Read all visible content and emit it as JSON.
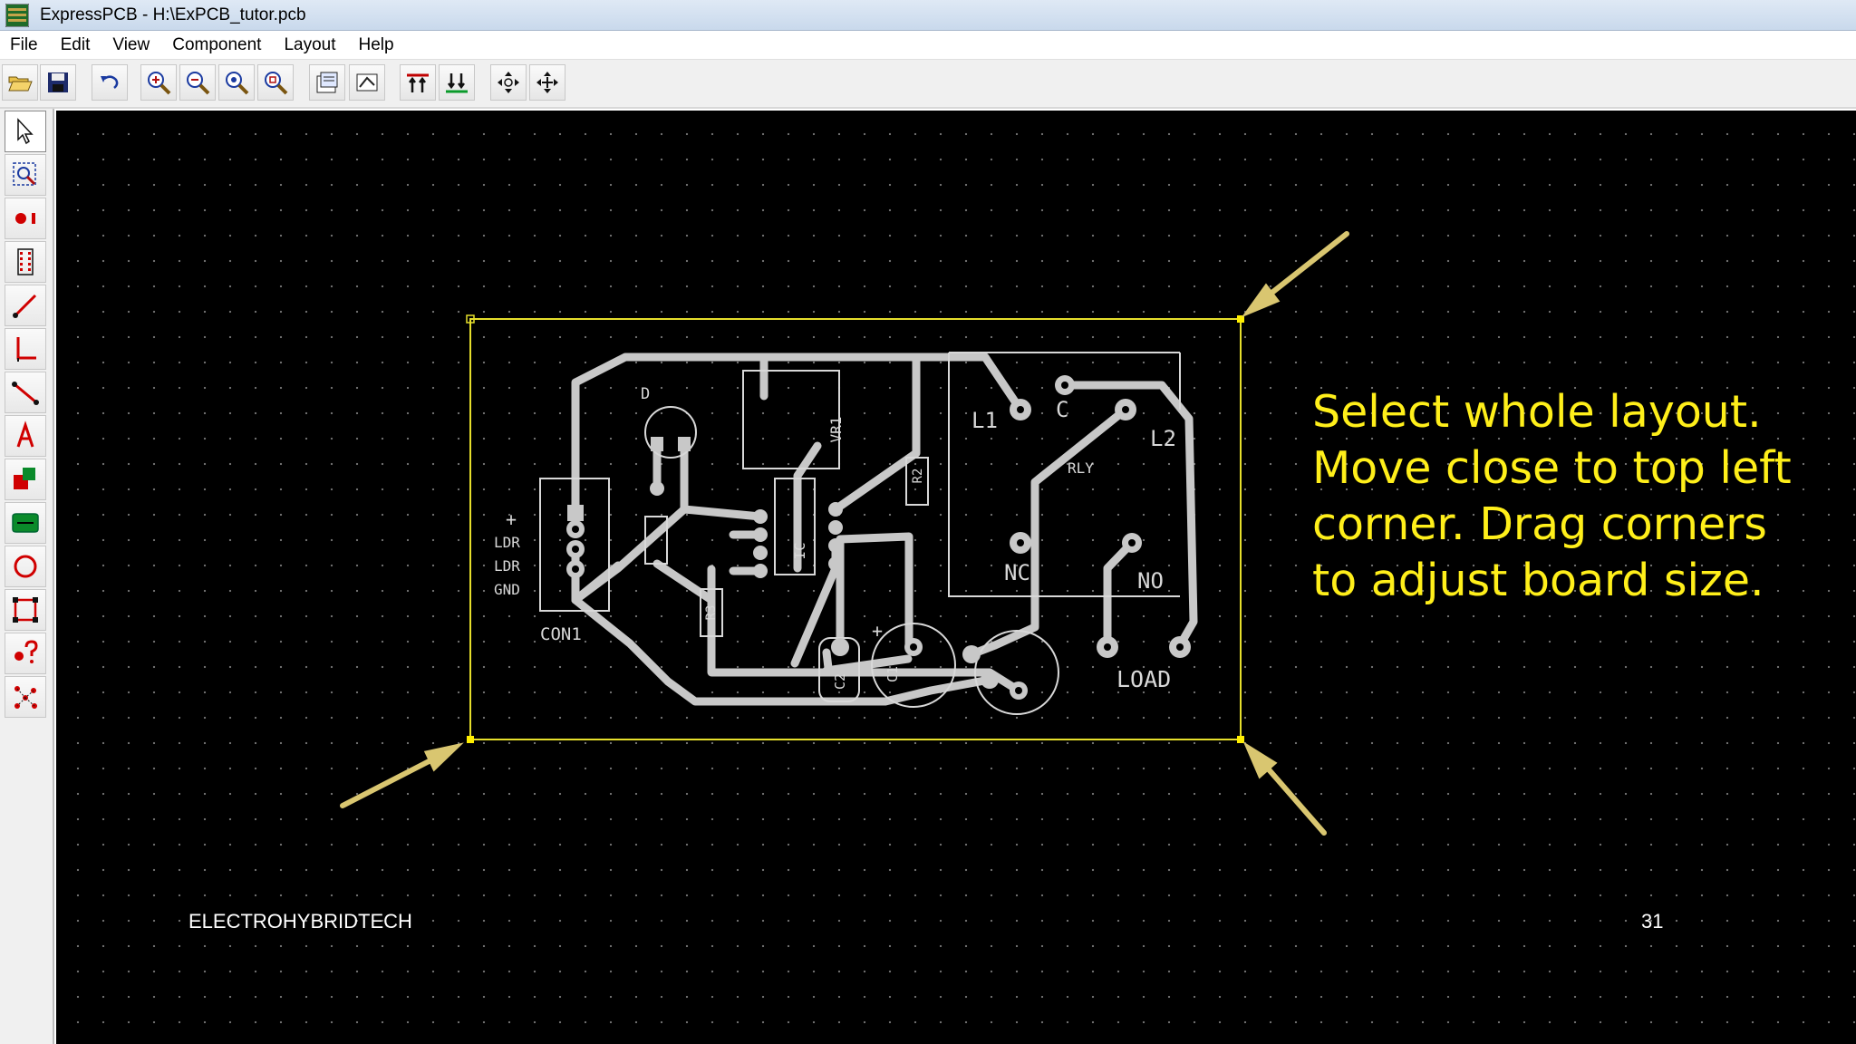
{
  "window": {
    "title": "ExpressPCB - H:\\ExPCB_tutor.pcb"
  },
  "menu": [
    {
      "label": "File"
    },
    {
      "label": "Edit"
    },
    {
      "label": "View"
    },
    {
      "label": "Component"
    },
    {
      "label": "Layout"
    },
    {
      "label": "Help"
    }
  ],
  "toolbar": {
    "icons": [
      "open-icon",
      "save-icon",
      "undo-icon",
      "zoom-in-icon",
      "zoom-out-icon",
      "zoom-window-icon",
      "zoom-fit-icon",
      "properties-icon",
      "component-manager-icon",
      "top-layer-icon",
      "bottom-layer-icon",
      "move-icon",
      "center-icon"
    ]
  },
  "palette": {
    "tools": [
      "select-arrow-tool",
      "zoom-area-tool",
      "pad-tool",
      "component-tool",
      "trace-tool",
      "trace-corner-tool",
      "line-tool",
      "text-tool",
      "layer-tool",
      "board-fill-tool",
      "circle-tool",
      "rectangle-board-tool",
      "query-pin-tool",
      "netlist-tool"
    ]
  },
  "canvas": {
    "instruction": "Select whole layout. Move close to top left corner. Drag corners to adjust board size.",
    "brand": "ELECTROHYBRIDTECH",
    "page_number": "31"
  },
  "board": {
    "labels": {
      "plus": "+",
      "ldr1": "LDR",
      "ldr2": "LDR",
      "gnd": "GND",
      "con1": "CON1",
      "diode": "D",
      "vr1": "VR1",
      "ic": "IC",
      "r2": "R2",
      "r3": "R3",
      "c2": "C2",
      "c1": "C1",
      "plus2": "+",
      "l1": "L1",
      "c": "C",
      "l2": "L2",
      "rly": "RLY",
      "nc": "NC",
      "no": "NO",
      "load": "LOAD"
    },
    "colors": {
      "outline": "#e6df2c",
      "trace": "#c8c8c8",
      "silkscreen": "#d8d8d8",
      "arrow": "#d9c670",
      "instruction_text": "#ffef1a"
    }
  }
}
